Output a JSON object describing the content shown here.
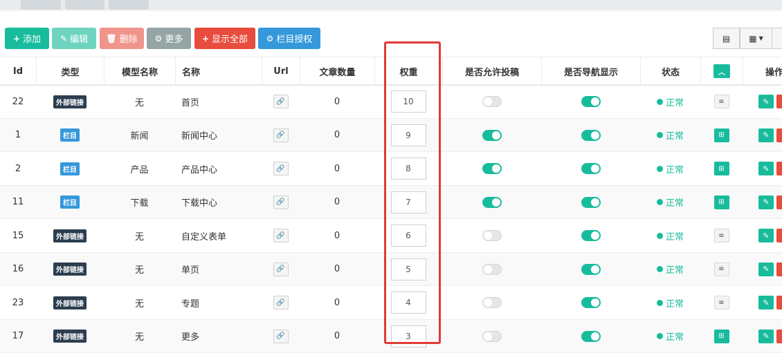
{
  "toolbar": {
    "add": "添加",
    "edit": "编辑",
    "delete": "删除",
    "more": "更多",
    "show_all": "显示全部",
    "column_auth": "栏目授权"
  },
  "headers": {
    "id": "Id",
    "type": "类型",
    "model": "模型名称",
    "name": "名称",
    "url": "Url",
    "articles": "文章数量",
    "weight": "权重",
    "allow_submit": "是否允许投稿",
    "nav_show": "是否导航显示",
    "status": "状态",
    "operate": "操作"
  },
  "rows": [
    {
      "id": "22",
      "type": "外部链接",
      "type_color": "dark",
      "model": "无",
      "name": "首页",
      "articles": "0",
      "weight": "10",
      "allow_submit": false,
      "nav_show": true,
      "status": "正常",
      "sub": "list"
    },
    {
      "id": "1",
      "type": "栏目",
      "type_color": "blue",
      "model": "新闻",
      "name": "新闻中心",
      "articles": "0",
      "weight": "9",
      "allow_submit": true,
      "nav_show": true,
      "status": "正常",
      "sub": "tree"
    },
    {
      "id": "2",
      "type": "栏目",
      "type_color": "blue",
      "model": "产品",
      "name": "产品中心",
      "articles": "0",
      "weight": "8",
      "allow_submit": true,
      "nav_show": true,
      "status": "正常",
      "sub": "tree"
    },
    {
      "id": "11",
      "type": "栏目",
      "type_color": "blue",
      "model": "下载",
      "name": "下载中心",
      "articles": "0",
      "weight": "7",
      "allow_submit": true,
      "nav_show": true,
      "status": "正常",
      "sub": "tree"
    },
    {
      "id": "15",
      "type": "外部链接",
      "type_color": "dark",
      "model": "无",
      "name": "自定义表单",
      "articles": "0",
      "weight": "6",
      "allow_submit": false,
      "nav_show": true,
      "status": "正常",
      "sub": "list"
    },
    {
      "id": "16",
      "type": "外部链接",
      "type_color": "dark",
      "model": "无",
      "name": "单页",
      "articles": "0",
      "weight": "5",
      "allow_submit": false,
      "nav_show": true,
      "status": "正常",
      "sub": "list"
    },
    {
      "id": "23",
      "type": "外部链接",
      "type_color": "dark",
      "model": "无",
      "name": "专题",
      "articles": "0",
      "weight": "4",
      "allow_submit": false,
      "nav_show": true,
      "status": "正常",
      "sub": "list"
    },
    {
      "id": "17",
      "type": "外部链接",
      "type_color": "dark",
      "model": "无",
      "name": "更多",
      "articles": "0",
      "weight": "3",
      "allow_submit": false,
      "nav_show": true,
      "status": "正常",
      "sub": "tree"
    }
  ],
  "colors": {
    "accent": "#18bc9c",
    "danger": "#e74c3c",
    "primary": "#3498db",
    "highlight": "#e03a36"
  },
  "icons": {
    "link": "link-icon",
    "list": "list-icon",
    "tree": "sitemap-icon",
    "edit": "pencil-icon",
    "chevron": "chevron-up-icon"
  }
}
